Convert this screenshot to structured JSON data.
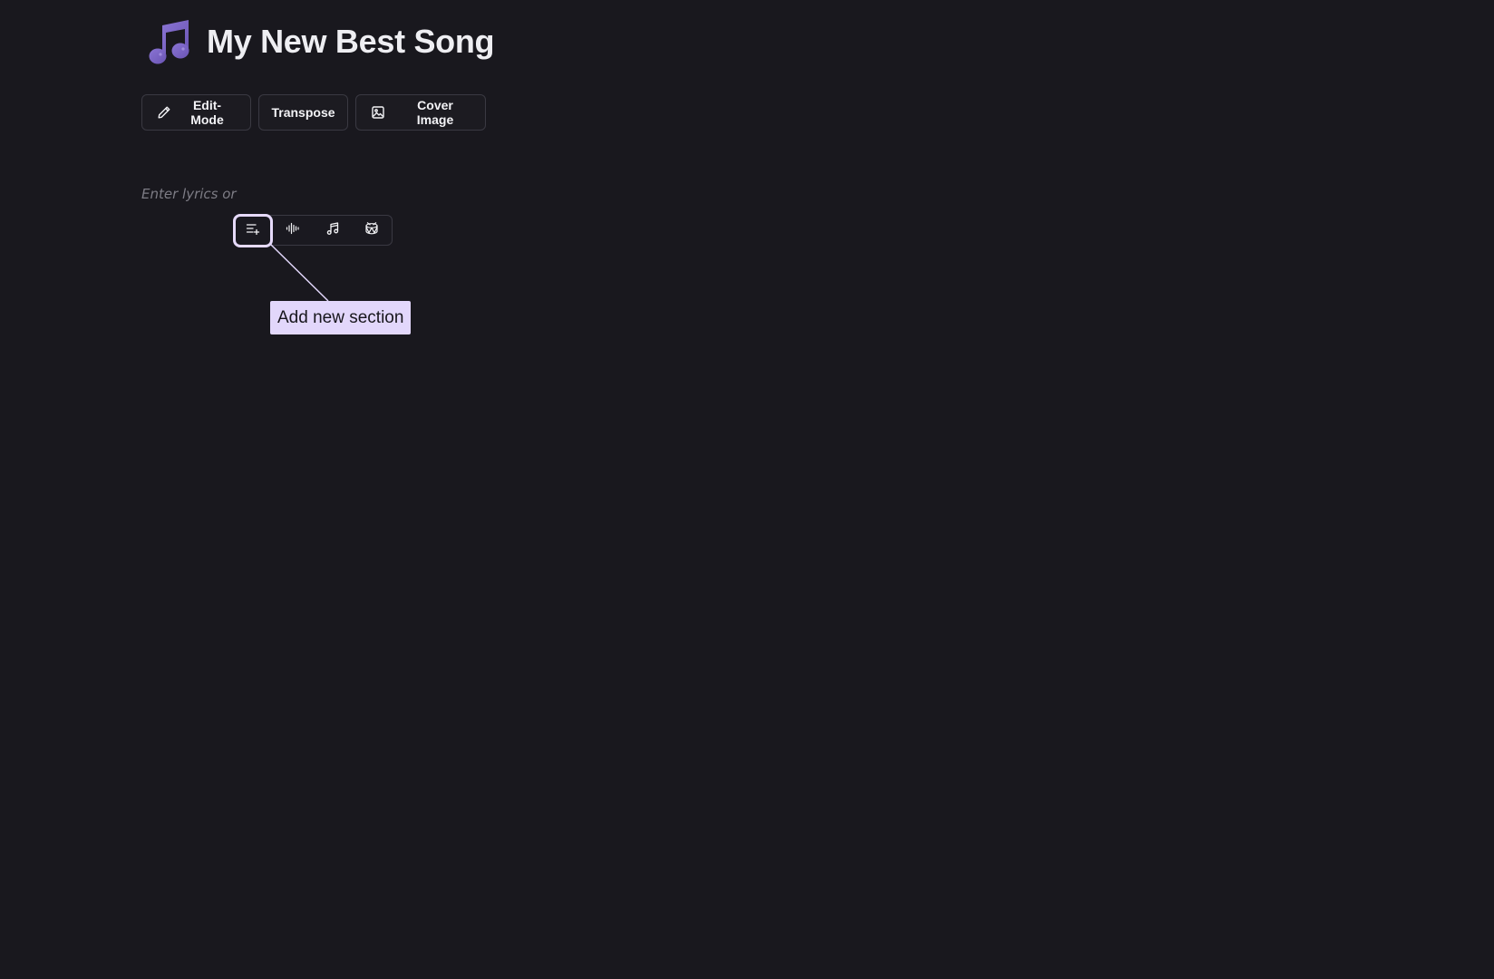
{
  "song": {
    "title": "My New Best Song",
    "icon": "music-note-icon"
  },
  "toolbar": {
    "edit_mode_label": "Edit-Mode",
    "edit_mode_icon": "pencil-icon",
    "transpose_label": "Transpose",
    "cover_image_label": "Cover Image",
    "cover_image_icon": "image-icon"
  },
  "editor": {
    "placeholder": "Enter lyrics or"
  },
  "insert_bar": {
    "items": [
      {
        "name": "add-section",
        "icon": "list-plus-icon",
        "active": true
      },
      {
        "name": "add-audio",
        "icon": "waveform-icon",
        "active": false
      },
      {
        "name": "add-chords",
        "icon": "music-notes-icon",
        "active": false
      },
      {
        "name": "add-drum",
        "icon": "drum-icon",
        "active": false
      }
    ]
  },
  "tooltip": {
    "text": "Add new section"
  },
  "colors": {
    "background": "#19181e",
    "accent": "#7b64c4",
    "tooltip_bg": "#e2d7fb",
    "border": "#3a3942"
  }
}
